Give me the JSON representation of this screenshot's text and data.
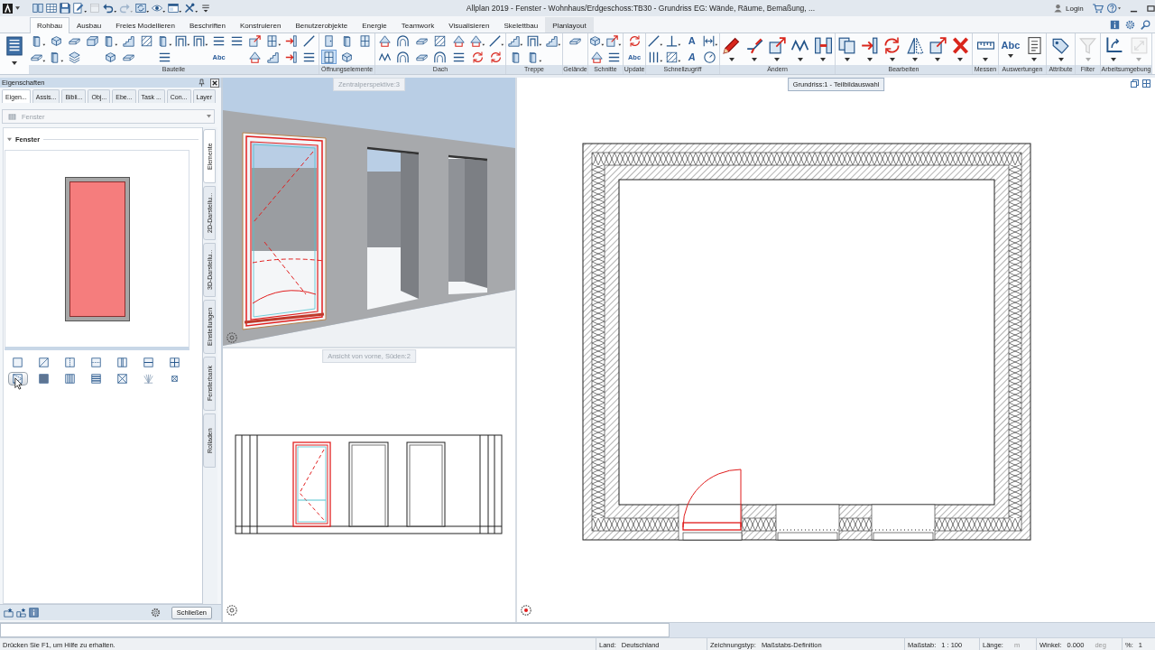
{
  "title_bar": {
    "quick_access": [
      {
        "disabled": false
      },
      {
        "disabled": false
      },
      {
        "disabled": false
      },
      {
        "disabled": false
      },
      {
        "disabled": true
      },
      {
        "disabled": false
      },
      {
        "disabled": true
      },
      {
        "disabled": false
      },
      {
        "disabled": false
      },
      {
        "disabled": false
      },
      {
        "disabled": false
      },
      {
        "disabled": false
      }
    ],
    "title": "Allplan 2019 - Fenster - Wohnhaus/Erdgeschoss:TB30 - Grundriss EG: Wände, Räume, Bemaßung, ...",
    "login": "Login"
  },
  "ribbon": {
    "tabs": [
      {
        "label": "Rohbau",
        "selected": true,
        "hovered": false
      },
      {
        "label": "Ausbau",
        "selected": false,
        "hovered": false
      },
      {
        "label": "Freies Modellieren",
        "selected": false,
        "hovered": false
      },
      {
        "label": "Beschriften",
        "selected": false,
        "hovered": false
      },
      {
        "label": "Konstruieren",
        "selected": false,
        "hovered": false
      },
      {
        "label": "Benutzerobjekte",
        "selected": false,
        "hovered": false
      },
      {
        "label": "Energie",
        "selected": false,
        "hovered": false
      },
      {
        "label": "Teamwork",
        "selected": false,
        "hovered": false
      },
      {
        "label": "Visualisieren",
        "selected": false,
        "hovered": false
      },
      {
        "label": "Skelettbau",
        "selected": false,
        "hovered": false
      },
      {
        "label": "Planlayout",
        "selected": false,
        "hovered": true
      }
    ],
    "groups": [
      {
        "label": "Bauteile",
        "tools": [
          {
            "selected": false,
            "disabled": false
          },
          {
            "selected": false,
            "disabled": false
          },
          {
            "selected": false,
            "disabled": false
          },
          {
            "selected": false,
            "disabled": false
          },
          {
            "selected": false,
            "disabled": false
          },
          {
            "selected": false,
            "disabled": false
          },
          {
            "selected": false,
            "disabled": false
          },
          {
            "selected": false,
            "disabled": false
          },
          {
            "selected": false,
            "disabled": false
          },
          {
            "selected": false,
            "disabled": false
          },
          {
            "selected": false,
            "disabled": false
          },
          {
            "selected": false,
            "disabled": false
          },
          {
            "selected": false,
            "disabled": false
          },
          {
            "selected": false,
            "disabled": false
          },
          {
            "selected": false,
            "disabled": false
          },
          {
            "selected": false,
            "disabled": false
          },
          {
            "selected": false,
            "disabled": false
          },
          {
            "selected": false,
            "disabled": false
          },
          {
            "selected": false,
            "disabled": false
          },
          {
            "selected": false,
            "disabled": false
          },
          {
            "selected": false,
            "disabled": false
          },
          {
            "selected": false,
            "disabled": false
          },
          {
            "glyph": "Abc",
            "selected": false,
            "disabled": false
          },
          {
            "selected": false,
            "disabled": false
          },
          {
            "selected": false,
            "disabled": false
          },
          {
            "selected": false,
            "disabled": false
          },
          {
            "selected": false,
            "disabled": false
          }
        ]
      },
      {
        "label": "Öffnungselemente",
        "tools": [
          {
            "selected": false,
            "disabled": false
          },
          {
            "selected": false,
            "disabled": false
          },
          {
            "selected": false,
            "disabled": false
          },
          {
            "selected": true,
            "disabled": false
          },
          {
            "selected": false,
            "disabled": false
          }
        ]
      },
      {
        "label": "Dach",
        "tools": [
          {
            "selected": false,
            "disabled": false
          },
          {
            "selected": false,
            "disabled": false
          },
          {
            "selected": false,
            "disabled": false
          },
          {
            "selected": false,
            "disabled": false
          },
          {
            "selected": false,
            "disabled": false
          },
          {
            "selected": false,
            "disabled": false
          },
          {
            "selected": false,
            "disabled": false
          },
          {
            "selected": false,
            "disabled": false
          },
          {
            "selected": false,
            "disabled": false
          },
          {
            "selected": false,
            "disabled": false
          },
          {
            "selected": false,
            "disabled": false
          },
          {
            "selected": false,
            "disabled": false
          },
          {
            "selected": false,
            "disabled": false
          },
          {
            "selected": false,
            "disabled": false
          }
        ]
      },
      {
        "label": "Treppe",
        "tools": [
          {
            "selected": false,
            "disabled": false
          },
          {
            "selected": false,
            "disabled": false
          },
          {
            "selected": false,
            "disabled": false
          },
          {
            "selected": false,
            "disabled": false
          },
          {
            "selected": false,
            "disabled": false
          }
        ]
      },
      {
        "label": "Gelände",
        "tools": [
          {
            "selected": false,
            "disabled": false
          }
        ]
      },
      {
        "label": "Schnitte",
        "tools": [
          {
            "selected": false,
            "disabled": false
          },
          {
            "selected": false,
            "disabled": false
          },
          {
            "selected": false,
            "disabled": false
          },
          {
            "selected": false,
            "disabled": false
          }
        ]
      },
      {
        "label": "Update",
        "tools": [
          {
            "selected": false,
            "disabled": false
          },
          {
            "glyph": "Abc",
            "selected": false,
            "disabled": false
          }
        ]
      },
      {
        "label": "Schnellzugriff",
        "tools": [
          {
            "selected": false,
            "disabled": false
          },
          {
            "selected": false,
            "disabled": false
          },
          {
            "glyph": "A",
            "selected": false,
            "disabled": false
          },
          {
            "selected": false,
            "disabled": false
          },
          {
            "selected": false,
            "disabled": false
          },
          {
            "selected": false,
            "disabled": false
          },
          {
            "glyph": "A",
            "selected": false,
            "disabled": false
          },
          {
            "selected": false,
            "disabled": false
          }
        ]
      },
      {
        "label": "Ändern",
        "tools": [
          {
            "selected": false,
            "disabled": false
          },
          {
            "selected": false,
            "disabled": false
          },
          {
            "selected": false,
            "disabled": false
          },
          {
            "selected": false,
            "disabled": false
          },
          {
            "selected": false,
            "disabled": false
          }
        ]
      },
      {
        "label": "Bearbeiten",
        "tools": [
          {
            "selected": false,
            "disabled": false
          },
          {
            "selected": false,
            "disabled": false
          },
          {
            "selected": false,
            "disabled": false
          },
          {
            "selected": false,
            "disabled": false
          },
          {
            "selected": false,
            "disabled": false
          },
          {
            "selected": false,
            "disabled": false
          }
        ]
      },
      {
        "label": "Messen",
        "tools": [
          {
            "selected": false,
            "disabled": false
          }
        ]
      },
      {
        "label": "Auswertungen",
        "tools": [
          {
            "glyph": "Abc",
            "selected": false,
            "disabled": false
          },
          {
            "selected": false,
            "disabled": false
          }
        ]
      },
      {
        "label": "Attribute",
        "tools": [
          {
            "selected": false,
            "disabled": false
          }
        ]
      },
      {
        "label": "Filter",
        "tools": [
          {
            "selected": false,
            "disabled": true
          }
        ]
      },
      {
        "label": "Arbeitsumgebung",
        "tools": [
          {
            "selected": false,
            "disabled": false
          },
          {
            "selected": false,
            "disabled": true
          }
        ]
      }
    ]
  },
  "properties_panel": {
    "title": "Eigenschaften",
    "tabs": [
      {
        "label": "Eigen...",
        "selected": true
      },
      {
        "label": "Assis...",
        "selected": false
      },
      {
        "label": "Bibli...",
        "selected": false
      },
      {
        "label": "Obj...",
        "selected": false
      },
      {
        "label": "Ebe...",
        "selected": false
      },
      {
        "label": "Task ...",
        "selected": false
      },
      {
        "label": "Con...",
        "selected": false
      },
      {
        "label": "Layer",
        "selected": false
      }
    ],
    "element_type": {
      "value": "Fenster",
      "disabled": true
    },
    "section": {
      "title": "Fenster",
      "expanded": true
    },
    "window_types": [
      {
        "selected": false
      },
      {
        "selected": false
      },
      {
        "selected": false
      },
      {
        "selected": false
      },
      {
        "selected": false
      },
      {
        "selected": false
      },
      {
        "selected": false
      },
      {
        "selected": true
      },
      {
        "selected": false
      },
      {
        "selected": false
      },
      {
        "selected": false
      },
      {
        "selected": false
      },
      {
        "selected": false
      },
      {
        "selected": false
      }
    ],
    "side_tabs": [
      {
        "label": "Elemente",
        "selected": true
      },
      {
        "label": "2D-Darstellu...",
        "selected": false
      },
      {
        "label": "3D-Darstellu...",
        "selected": false
      },
      {
        "label": "Einstellungen",
        "selected": false
      },
      {
        "label": "Fensterbank",
        "selected": false
      },
      {
        "label": "Rolladen",
        "selected": false
      }
    ],
    "close_button": "Schließen"
  },
  "viewports": [
    {
      "kind": "perspective",
      "label": "Zentralperspektive:3",
      "active": false
    },
    {
      "kind": "plan",
      "label": "Grundriss:1 - Teilbildauswahl",
      "active": true
    },
    {
      "kind": "elevation",
      "label": "Ansicht von vorne, Süden:2",
      "active": false
    }
  ],
  "status_bar": {
    "hint": "Drücken Sie F1, um Hilfe zu erhalten.",
    "fields": [
      {
        "label": "Land:",
        "value": "Deutschland"
      },
      {
        "label": "Zeichnungstyp:",
        "value": "Maßstabs-Definition"
      },
      {
        "label": "Maßstab:",
        "value": "1 : 100"
      },
      {
        "label": "Länge:",
        "unit": "m"
      },
      {
        "label": "Winkel:",
        "value": "0.000",
        "unit": "deg"
      },
      {
        "label": "%:",
        "value": "1"
      }
    ]
  }
}
